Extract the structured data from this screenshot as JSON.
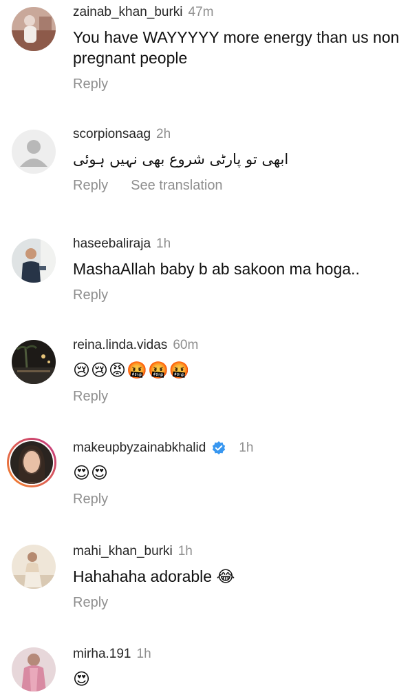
{
  "comments": [
    {
      "username": "zainab_khan_burki",
      "time": "47m",
      "text": "You have WAYYYYY more energy than us non pregnant people",
      "reply_label": "Reply"
    },
    {
      "username": "scorpionsaag",
      "time": "2h",
      "text": "ابھی تو پارٹی شروع بھی نہیں ہوئی",
      "reply_label": "Reply",
      "translate_label": "See translation"
    },
    {
      "username": "haseebaliraja",
      "time": "1h",
      "text": "MashaAllah baby b ab sakoon ma hoga..",
      "reply_label": "Reply"
    },
    {
      "username": "reina.linda.vidas",
      "time": "60m",
      "text": "😢😢😡🤬🤬🤬",
      "reply_label": "Reply"
    },
    {
      "username": "makeupbyzainabkhalid",
      "time": "1h",
      "text": "😍😍",
      "reply_label": "Reply",
      "verified": true
    },
    {
      "username": "mahi_khan_burki",
      "time": "1h",
      "text": "Hahahaha adorable 😂",
      "reply_label": "Reply"
    },
    {
      "username": "mirha.191",
      "time": "1h",
      "text": "😍",
      "reply_label": ""
    }
  ],
  "colors": {
    "username": "#262626",
    "secondary": "#8e8e8e",
    "verified": "#3897f0",
    "story_ring_start": "#f58529",
    "story_ring_end": "#c13584"
  },
  "icons": {
    "verified": "verified-badge-icon",
    "default_avatar": "default-user-icon"
  }
}
